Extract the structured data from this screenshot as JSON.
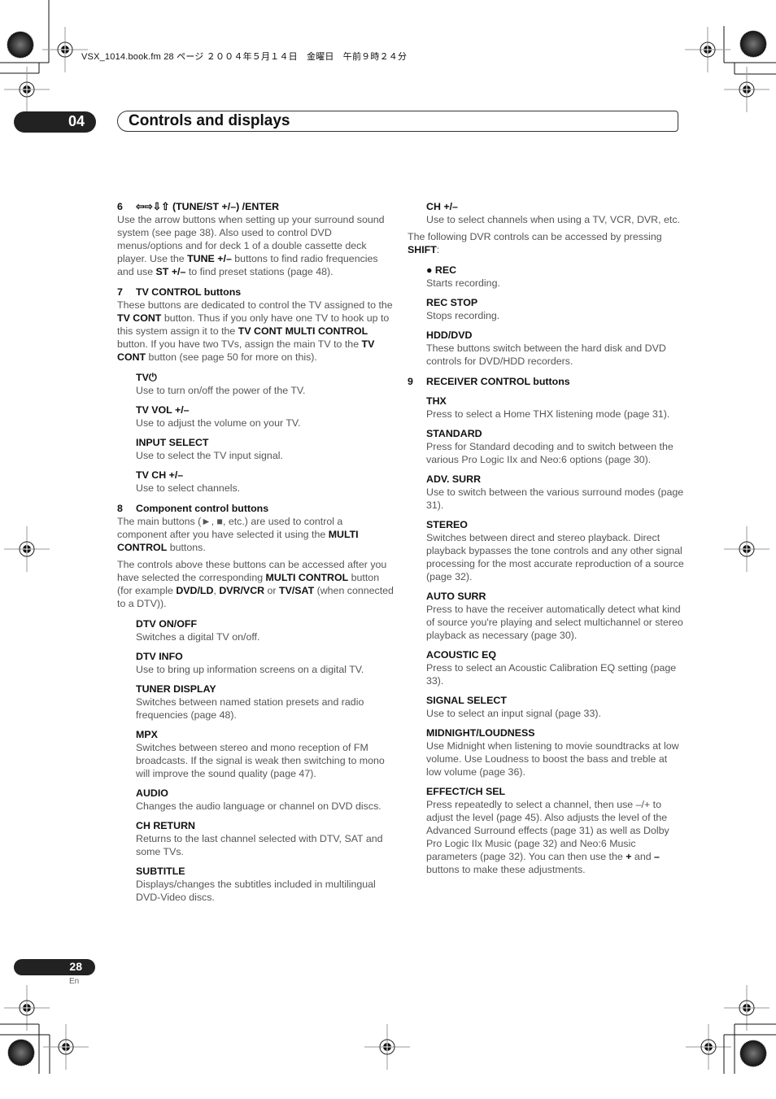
{
  "print_header": "VSX_1014.book.fm  28 ページ  ２００４年５月１４日　金曜日　午前９時２４分",
  "chapter": {
    "number": "04",
    "title": "Controls and displays"
  },
  "footer": {
    "page_number": "28",
    "language": "En"
  },
  "left_column": {
    "s6": {
      "num": "6",
      "title": "⇦⇨⇩⇧ (TUNE/ST +/–) /ENTER",
      "t1": "Use the arrow buttons when setting up your surround sound system (see page 38). Also used to control DVD menus/options and for deck 1 of a double cassette deck player. Use the ",
      "b1": "TUNE +/–",
      "t2": " buttons to find radio frequencies and use ",
      "b2": "ST +/–",
      "t3": " to find preset stations (page 48)."
    },
    "s7": {
      "num": "7",
      "title": "TV CONTROL buttons",
      "t1": "These buttons are dedicated to control the TV assigned to the ",
      "b1": "TV CONT",
      "t2": " button. Thus if you only have one TV to hook up to this system assign it to the ",
      "b2": "TV CONT MULTI CONTROL",
      "t3": " button. If you have two TVs, assign the main TV to the ",
      "b3": "TV CONT",
      "t4": " button (see page 50 for more on this).",
      "items": [
        {
          "label": "TV⏻",
          "desc": "Use to turn on/off the power of the TV."
        },
        {
          "label": "TV VOL +/–",
          "desc": "Use to adjust the volume on your TV."
        },
        {
          "label": "INPUT SELECT",
          "desc": "Use to select the TV input signal."
        },
        {
          "label": "TV CH +/–",
          "desc": "Use to select channels."
        }
      ]
    },
    "s8": {
      "num": "8",
      "title": "Component control buttons",
      "t1": "The main buttons (►, ■, etc.) are used to control a component after you have selected it using the ",
      "b1": "MULTI CONTROL",
      "t2": " buttons.",
      "p2_t1": "The controls above these buttons can be accessed after you have selected the corresponding ",
      "p2_b1": "MULTI CONTROL",
      "p2_t2": " button (for example ",
      "p2_b2": "DVD/LD",
      "p2_t3": ", ",
      "p2_b3": "DVR/VCR",
      "p2_t4": " or ",
      "p2_b4": "TV/SAT",
      "p2_t5": " (when connected to a DTV)).",
      "items": [
        {
          "label": "DTV ON/OFF",
          "desc": "Switches a digital TV on/off."
        },
        {
          "label": "DTV INFO",
          "desc": "Use to bring up information screens on a digital TV."
        },
        {
          "label": "TUNER DISPLAY",
          "desc": "Switches between named station presets and radio frequencies (page 48)."
        },
        {
          "label": "MPX",
          "desc": "Switches between stereo and mono reception of FM broadcasts. If the signal is weak then switching to mono will improve the sound quality (page 47)."
        },
        {
          "label": "AUDIO",
          "desc": "Changes the audio language or channel on DVD discs."
        },
        {
          "label": "CH RETURN",
          "desc": "Returns to the last channel selected with DTV, SAT and some TVs."
        },
        {
          "label": "SUBTITLE",
          "desc": "Displays/changes the subtitles included in multilingual DVD-Video discs."
        }
      ]
    }
  },
  "right_column": {
    "ch": {
      "label": "CH +/–",
      "desc": "Use to select channels when using a TV, VCR, DVR, etc."
    },
    "dvr_intro": {
      "t1": "The following DVR controls can be accessed by pressing ",
      "b1": "SHIFT",
      "t2": ":"
    },
    "dvr_items": [
      {
        "label": "● REC",
        "desc": "Starts recording."
      },
      {
        "label": "REC STOP",
        "desc": "Stops recording."
      },
      {
        "label": "HDD/DVD",
        "desc": "These buttons switch between the hard disk and DVD controls for DVD/HDD recorders."
      }
    ],
    "s9": {
      "num": "9",
      "title": "RECEIVER CONTROL buttons",
      "items": [
        {
          "label": "THX",
          "desc": "Press to select a Home THX listening mode (page 31)."
        },
        {
          "label": "STANDARD",
          "desc": "Press for Standard decoding and to switch between the various Pro Logic IIx and Neo:6 options (page 30)."
        },
        {
          "label": "ADV. SURR",
          "desc": "Use to switch between the various surround modes (page 31)."
        },
        {
          "label": "STEREO",
          "desc": "Switches between direct and stereo playback. Direct playback bypasses the tone controls and any other signal processing for the most accurate reproduction of a source (page 32)."
        },
        {
          "label": "AUTO SURR",
          "desc": "Press to have the receiver automatically detect what kind of source you're playing and select multichannel or stereo playback as necessary (page 30)."
        },
        {
          "label": "ACOUSTIC EQ",
          "desc": "Press to select an Acoustic Calibration EQ setting (page 33)."
        },
        {
          "label": "SIGNAL SELECT",
          "desc": "Use to select an input signal (page 33)."
        },
        {
          "label": "MIDNIGHT/LOUDNESS",
          "desc": "Use Midnight when listening to movie soundtracks at low volume. Use Loudness to boost the bass and treble at low volume (page 36)."
        }
      ],
      "effect": {
        "label": "EFFECT/CH SEL",
        "t1": "Press repeatedly to select a channel, then use –/+ to adjust the level (page 45). Also adjusts the level of the Advanced Surround effects (page 31) as well as Dolby Pro Logic IIx Music (page 32) and Neo:6 Music parameters (page 32). You can then use the ",
        "b1": "+",
        "t2": " and ",
        "b2": "–",
        "t3": " buttons to make these adjustments."
      }
    }
  }
}
